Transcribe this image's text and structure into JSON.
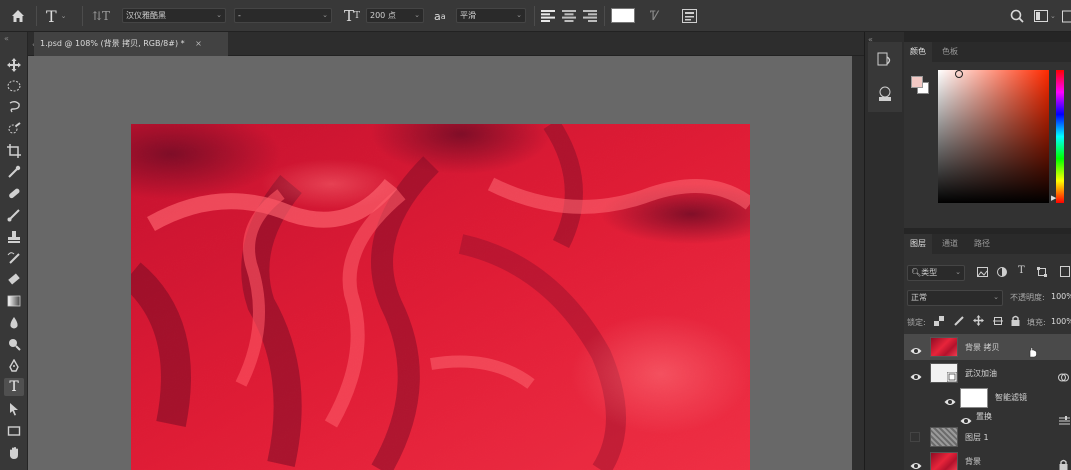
{
  "options_bar": {
    "font_family": "汉仪雅酷黑",
    "font_style": "-",
    "font_size": "200 点",
    "antialias": "平滑",
    "text_color": "#ffffff"
  },
  "document": {
    "tab_title": "1.psd @ 108% (背景 拷贝, RGB/8#) *",
    "close_glyph": "×"
  },
  "color_panel": {
    "tabs": [
      "颜色",
      "色板"
    ],
    "foreground": "#f2c9c4",
    "background": "#ffffff",
    "hue_color": "#ff2a00"
  },
  "layers_panel": {
    "tabs": [
      "图层",
      "通道",
      "路径"
    ],
    "filter_label": "类型",
    "blend_mode": "正常",
    "opacity_label": "不透明度:",
    "opacity_value": "100%",
    "lock_label": "锁定:",
    "fill_label": "填充:",
    "fill_value": "100%",
    "layers": [
      {
        "name": "背景 拷贝",
        "visible": true,
        "selected": true
      },
      {
        "name": "武汉加油",
        "visible": true,
        "selected": false
      },
      {
        "name": "智能滤镜",
        "visible": true,
        "selected": false
      },
      {
        "name": "置换",
        "visible": true,
        "selected": false
      },
      {
        "name": "图层 1",
        "visible": false,
        "selected": false
      },
      {
        "name": "背景",
        "visible": true,
        "selected": false
      }
    ]
  },
  "icons": [
    "home-icon",
    "text-tool-icon",
    "text-orientation-icon",
    "font-size-icon",
    "antialias-icon",
    "align-left-icon",
    "align-center-icon",
    "align-right-icon",
    "warp-text-icon",
    "character-panel-icon",
    "search-icon",
    "workspace-icon",
    "share-icon"
  ]
}
